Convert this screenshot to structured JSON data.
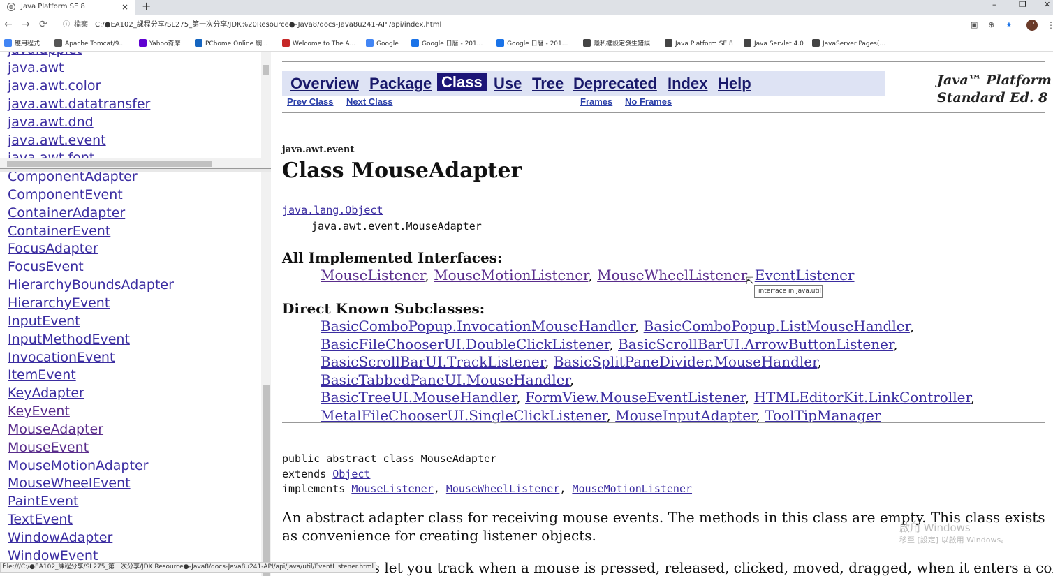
{
  "browser": {
    "tab_title": "Java Platform SE 8",
    "tab_close": "×",
    "new_tab": "+",
    "window_controls": [
      "–",
      "❐",
      "✕"
    ],
    "nav": {
      "back": "←",
      "forward": "→",
      "reload": "⟳"
    },
    "address": {
      "info_icon": "ⓘ",
      "scheme_label": "檔案",
      "url": "C:/●EA102_課程分享/SL275_第一次分享/JDK%20Resource●-Java8/docs-Java8u241-API/api/index.html"
    },
    "profile_initial": "P",
    "menu_icon": "⋮",
    "bookmarks": [
      {
        "icon": "apps-grid-icon",
        "label": "應用程式",
        "color": "#4285f4"
      },
      {
        "icon": "tomcat-icon",
        "label": "Apache Tomcat/9....",
        "color": "#555555"
      },
      {
        "icon": "yahoo-icon",
        "label": "Yahoo奇摩",
        "color": "#5f01d1"
      },
      {
        "icon": "pchome-icon",
        "label": "PChome Online 網...",
        "color": "#1565c0"
      },
      {
        "icon": "feather-icon",
        "label": "Welcome to The A...",
        "color": "#c62828"
      },
      {
        "icon": "google-icon",
        "label": "Google",
        "color": "#4285f4"
      },
      {
        "icon": "calendar-22-icon",
        "label": "Google 日曆 - 201...",
        "color": "#1a73e8"
      },
      {
        "icon": "calendar-30-icon",
        "label": "Google 日曆 - 201...",
        "color": "#1a73e8"
      },
      {
        "icon": "globe-icon",
        "label": "隱私權設定發生錯誤",
        "color": "#444444"
      },
      {
        "icon": "globe-icon",
        "label": "Java Platform SE 8",
        "color": "#444444"
      },
      {
        "icon": "globe-icon",
        "label": "Java Servlet 4.0",
        "color": "#444444"
      },
      {
        "icon": "globe-icon",
        "label": "JavaServer Pages(...",
        "color": "#444444"
      }
    ],
    "status_url": "file:///C:/●EA102_課程分享/SL275_第一次分享/JDK Resource●-Java8/docs-Java8u241-API/api/java/util/EventListener.html"
  },
  "packages": [
    "java.applet",
    "java.awt",
    "java.awt.color",
    "java.awt.datatransfer",
    "java.awt.dnd",
    "java.awt.event",
    "java.awt.font"
  ],
  "classes": [
    {
      "name": "ComponentAdapter",
      "visited": false
    },
    {
      "name": "ComponentEvent",
      "visited": false
    },
    {
      "name": "ContainerAdapter",
      "visited": false
    },
    {
      "name": "ContainerEvent",
      "visited": false
    },
    {
      "name": "FocusAdapter",
      "visited": false
    },
    {
      "name": "FocusEvent",
      "visited": false
    },
    {
      "name": "HierarchyBoundsAdapter",
      "visited": false
    },
    {
      "name": "HierarchyEvent",
      "visited": false
    },
    {
      "name": "InputEvent",
      "visited": false
    },
    {
      "name": "InputMethodEvent",
      "visited": false
    },
    {
      "name": "InvocationEvent",
      "visited": false
    },
    {
      "name": "ItemEvent",
      "visited": false
    },
    {
      "name": "KeyAdapter",
      "visited": false
    },
    {
      "name": "KeyEvent",
      "visited": true
    },
    {
      "name": "MouseAdapter",
      "visited": true
    },
    {
      "name": "MouseEvent",
      "visited": true
    },
    {
      "name": "MouseMotionAdapter",
      "visited": false
    },
    {
      "name": "MouseWheelEvent",
      "visited": false
    },
    {
      "name": "PaintEvent",
      "visited": false
    },
    {
      "name": "TextEvent",
      "visited": false
    },
    {
      "name": "WindowAdapter",
      "visited": false
    },
    {
      "name": "WindowEvent",
      "visited": false
    }
  ],
  "doc": {
    "nav": {
      "overview": "Overview",
      "package": "Package",
      "class": "Class",
      "use": "Use",
      "tree": "Tree",
      "deprecated": "Deprecated",
      "index": "Index",
      "help": "Help"
    },
    "subnav": {
      "prev": "Prev Class",
      "next": "Next Class",
      "frames": "Frames",
      "noframes": "No Frames"
    },
    "platform_line1": "Java™ Platform",
    "platform_line2": "Standard Ed. 8",
    "package_name": "java.awt.event",
    "class_title": "Class MouseAdapter",
    "hierarchy_root": "java.lang.Object",
    "hierarchy_class": "java.awt.event.MouseAdapter",
    "impl_heading": "All Implemented Interfaces:",
    "interfaces": [
      {
        "name": "MouseListener",
        "visited": true
      },
      {
        "name": "MouseMotionListener",
        "visited": true
      },
      {
        "name": "MouseWheelListener",
        "visited": true
      },
      {
        "name": "EventListener",
        "visited": false
      }
    ],
    "tooltip": "interface in java.util",
    "sub_heading": "Direct Known Subclasses:",
    "subclasses": [
      [
        "BasicComboPopup.InvocationMouseHandler",
        "BasicComboPopup.ListMouseHandler"
      ],
      [
        "BasicFileChooserUI.DoubleClickListener",
        "BasicScrollBarUI.ArrowButtonListener"
      ],
      [
        "BasicScrollBarUI.TrackListener",
        "BasicSplitPaneDivider.MouseHandler",
        "BasicTabbedPaneUI.MouseHandler"
      ],
      [
        "BasicTreeUI.MouseHandler",
        "FormView.MouseEventListener",
        "HTMLEditorKit.LinkController"
      ],
      [
        "MetalFileChooserUI.SingleClickListener",
        "MouseInputAdapter",
        "ToolTipManager"
      ]
    ],
    "decl_line1": "public abstract class MouseAdapter",
    "decl_extends": "extends ",
    "decl_object": "Object",
    "decl_implements": "implements ",
    "decl_impls": [
      "MouseListener",
      "MouseWheelListener",
      "MouseMotionListener"
    ],
    "description": "An abstract adapter class for receiving mouse events. The methods in this class are empty. This class exists as convenience for creating listener objects.",
    "description2": "Mouse events let you track when a mouse is pressed, released, clicked, moved, dragged, when it enters a component,"
  },
  "watermark": {
    "line1": "啟用 Windows",
    "line2": "移至 [設定] 以啟用 Windows。"
  }
}
